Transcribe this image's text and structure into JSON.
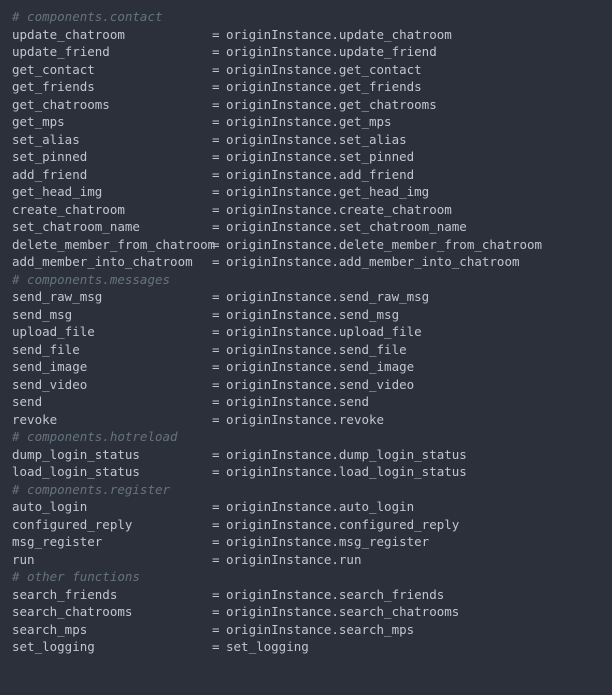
{
  "groups": [
    {
      "comment": "# components.contact",
      "lines": [
        {
          "lhs": "update_chatroom",
          "rhs_obj": "originInstance",
          "rhs_method": "update_chatroom"
        },
        {
          "lhs": "update_friend",
          "rhs_obj": "originInstance",
          "rhs_method": "update_friend"
        },
        {
          "lhs": "get_contact",
          "rhs_obj": "originInstance",
          "rhs_method": "get_contact"
        },
        {
          "lhs": "get_friends",
          "rhs_obj": "originInstance",
          "rhs_method": "get_friends"
        },
        {
          "lhs": "get_chatrooms",
          "rhs_obj": "originInstance",
          "rhs_method": "get_chatrooms"
        },
        {
          "lhs": "get_mps",
          "rhs_obj": "originInstance",
          "rhs_method": "get_mps"
        },
        {
          "lhs": "set_alias",
          "rhs_obj": "originInstance",
          "rhs_method": "set_alias"
        },
        {
          "lhs": "set_pinned",
          "rhs_obj": "originInstance",
          "rhs_method": "set_pinned"
        },
        {
          "lhs": "add_friend",
          "rhs_obj": "originInstance",
          "rhs_method": "add_friend"
        },
        {
          "lhs": "get_head_img",
          "rhs_obj": "originInstance",
          "rhs_method": "get_head_img"
        },
        {
          "lhs": "create_chatroom",
          "rhs_obj": "originInstance",
          "rhs_method": "create_chatroom"
        },
        {
          "lhs": "set_chatroom_name",
          "rhs_obj": "originInstance",
          "rhs_method": "set_chatroom_name"
        },
        {
          "lhs": "delete_member_from_chatroom",
          "rhs_obj": "originInstance",
          "rhs_method": "delete_member_from_chatroom"
        },
        {
          "lhs": "add_member_into_chatroom",
          "rhs_obj": "originInstance",
          "rhs_method": "add_member_into_chatroom"
        }
      ]
    },
    {
      "comment": "# components.messages",
      "lines": [
        {
          "lhs": "send_raw_msg",
          "rhs_obj": "originInstance",
          "rhs_method": "send_raw_msg"
        },
        {
          "lhs": "send_msg",
          "rhs_obj": "originInstance",
          "rhs_method": "send_msg"
        },
        {
          "lhs": "upload_file",
          "rhs_obj": "originInstance",
          "rhs_method": "upload_file"
        },
        {
          "lhs": "send_file",
          "rhs_obj": "originInstance",
          "rhs_method": "send_file"
        },
        {
          "lhs": "send_image",
          "rhs_obj": "originInstance",
          "rhs_method": "send_image"
        },
        {
          "lhs": "send_video",
          "rhs_obj": "originInstance",
          "rhs_method": "send_video"
        },
        {
          "lhs": "send",
          "rhs_obj": "originInstance",
          "rhs_method": "send"
        },
        {
          "lhs": "revoke",
          "rhs_obj": "originInstance",
          "rhs_method": "revoke"
        }
      ]
    },
    {
      "comment": "# components.hotreload",
      "lines": [
        {
          "lhs": "dump_login_status",
          "rhs_obj": "originInstance",
          "rhs_method": "dump_login_status"
        },
        {
          "lhs": "load_login_status",
          "rhs_obj": "originInstance",
          "rhs_method": "load_login_status"
        }
      ]
    },
    {
      "comment": "# components.register",
      "lines": [
        {
          "lhs": "auto_login",
          "rhs_obj": "originInstance",
          "rhs_method": "auto_login"
        },
        {
          "lhs": "configured_reply",
          "rhs_obj": "originInstance",
          "rhs_method": "configured_reply"
        },
        {
          "lhs": "msg_register",
          "rhs_obj": "originInstance",
          "rhs_method": "msg_register"
        },
        {
          "lhs": "run",
          "rhs_obj": "originInstance",
          "rhs_method": "run"
        }
      ]
    },
    {
      "comment": "# other functions",
      "lines": [
        {
          "lhs": "search_friends",
          "rhs_obj": "originInstance",
          "rhs_method": "search_friends"
        },
        {
          "lhs": "search_chatrooms",
          "rhs_obj": "originInstance",
          "rhs_method": "search_chatrooms"
        },
        {
          "lhs": "search_mps",
          "rhs_obj": "originInstance",
          "rhs_method": "search_mps"
        },
        {
          "lhs": "set_logging",
          "rhs_obj": "",
          "rhs_method": "set_logging"
        }
      ]
    }
  ]
}
